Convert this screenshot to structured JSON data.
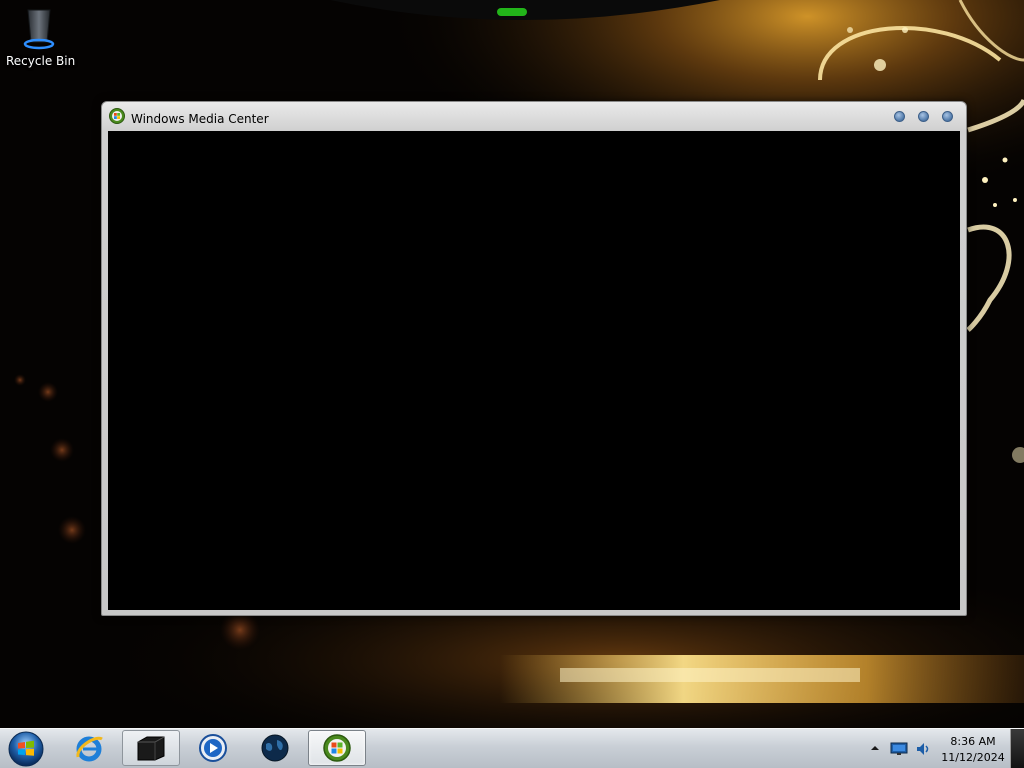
{
  "desktop": {
    "icons": [
      {
        "label": "Recycle Bin",
        "icon": "recycle-bin-icon"
      }
    ]
  },
  "window": {
    "title": "Windows Media Center",
    "icon": "windows-media-center-icon",
    "controls": [
      "minimize",
      "maximize",
      "close"
    ],
    "content_background": "#000000"
  },
  "taskbar": {
    "start_icon": "windows-start-orb-icon",
    "buttons": [
      {
        "icon": "internet-explorer-icon",
        "state": "pinned"
      },
      {
        "icon": "black-folder-icon",
        "state": "open"
      },
      {
        "icon": "media-player-icon",
        "state": "pinned"
      },
      {
        "icon": "globe-icon",
        "state": "pinned"
      },
      {
        "icon": "windows-media-center-icon",
        "state": "active"
      }
    ],
    "tray_icons": [
      "show-hidden-icons-arrow",
      "monitor-icon",
      "sound-icon"
    ],
    "clock": {
      "time": "8:36 AM",
      "date": "11/12/2024"
    }
  },
  "colors": {
    "wallpaper_base": "#050302",
    "wallpaper_accent": "#f2b12e",
    "taskbar": "#c9cfd6",
    "window_frame": "#cfcfcf"
  }
}
